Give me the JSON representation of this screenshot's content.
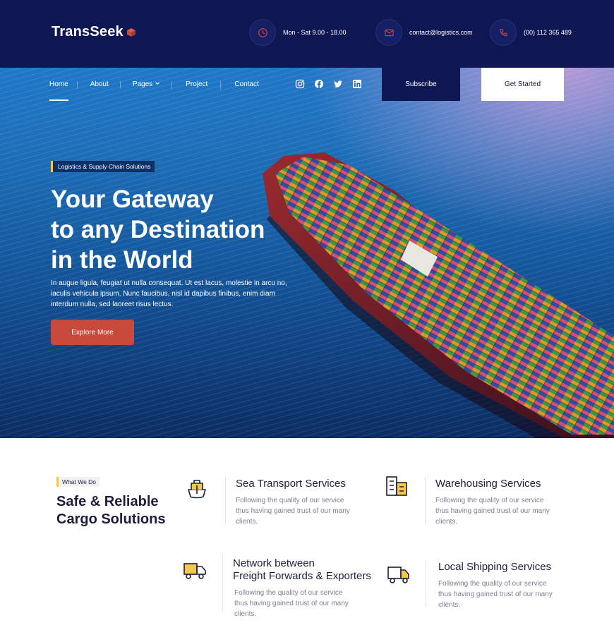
{
  "brand": {
    "name": "TransSeek"
  },
  "contacts": [
    {
      "icon": "clock-icon",
      "text": "Mon - Sat 9.00 - 18.00"
    },
    {
      "icon": "mail-icon",
      "text": "contact@logistics.com"
    },
    {
      "icon": "phone-icon",
      "text": "(00) 112 365 489"
    }
  ],
  "nav": {
    "items": [
      {
        "label": "Home",
        "active": true
      },
      {
        "label": "About"
      },
      {
        "label": "Pages",
        "has_dropdown": true
      },
      {
        "label": "Project"
      },
      {
        "label": "Contact"
      }
    ],
    "socials": [
      "instagram-icon",
      "facebook-icon",
      "twitter-icon",
      "linkedin-icon"
    ],
    "subscribe_label": "Subscribe",
    "get_started_label": "Get Started"
  },
  "hero": {
    "tag": "Logistics & Supply Chain Solutions",
    "title_lines": [
      "Your Gateway",
      "to any Destination",
      "in the World"
    ],
    "description": "In augue ligula, feugiat ut nulla consequat. Ut est lacus, molestie in arcu no, iaculis vehicula ipsum. Nunc faucibus, nisl id dapibus finibus, enim diam interdum nulla, sed laoreet risus lectus.",
    "cta_label": "Explore More"
  },
  "services_section": {
    "tag": "What We Do",
    "title_lines": [
      "Safe & Reliable",
      "Cargo Solutions"
    ],
    "items": [
      {
        "icon": "ship-icon",
        "title_lines": [
          "Sea Transport Services"
        ],
        "description": "Following the quality of our service thus having gained trust of our many clients."
      },
      {
        "icon": "warehouse-icon",
        "title_lines": [
          "Warehousing Services"
        ],
        "description": "Following the quality of our service thus having gained trust of our many clients."
      },
      {
        "icon": "truck-icon",
        "title_lines": [
          "Network between",
          "Freight Forwards & Exporters"
        ],
        "description": "Following the quality of our service thus having gained trust of our many clients."
      },
      {
        "icon": "delivery-truck-icon",
        "title_lines": [
          "Local Shipping Services"
        ],
        "description": "Following the quality of our service thus having gained trust of our many clients."
      }
    ]
  },
  "colors": {
    "navy": "#0e1752",
    "accent_red": "#c84a3c",
    "accent_yellow": "#f2c94c",
    "text_dark": "#1b1f3b",
    "text_muted": "#7b7f93"
  }
}
